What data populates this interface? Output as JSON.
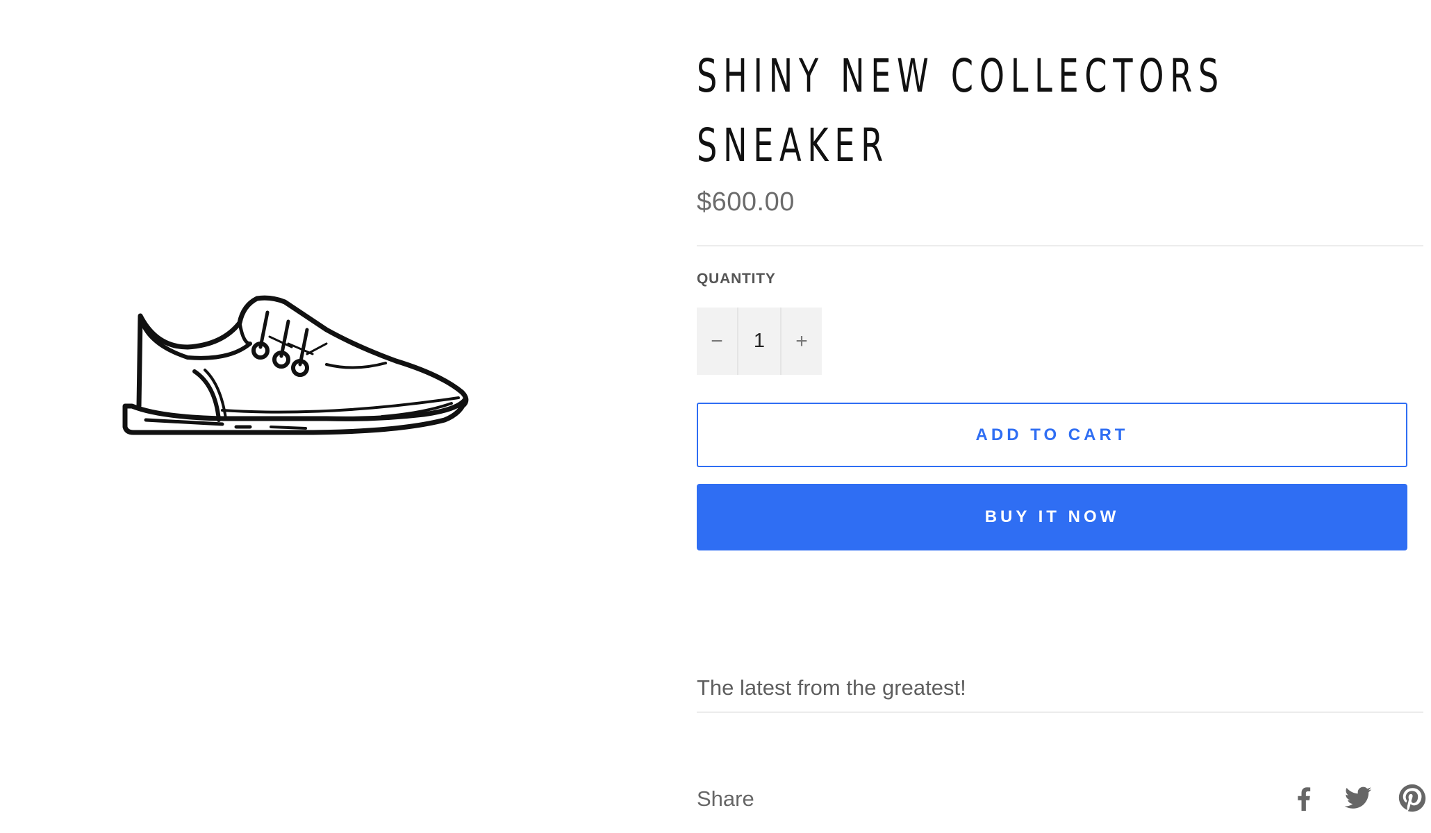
{
  "product": {
    "title": "SHINY NEW COLLECTORS SNEAKER",
    "price": "$600.00",
    "image_icon": "sneaker-illustration",
    "description": "The latest from the greatest!"
  },
  "quantity": {
    "label": "QUANTITY",
    "decrement_symbol": "−",
    "value": "1",
    "increment_symbol": "+"
  },
  "actions": {
    "add_to_cart": "ADD TO CART",
    "buy_now": "BUY IT NOW"
  },
  "share": {
    "label": "Share",
    "icons": [
      "facebook-icon",
      "twitter-icon",
      "pinterest-icon"
    ]
  },
  "colors": {
    "accent": "#2f6ef3",
    "title": "#111111",
    "muted": "#6b6b6b",
    "qty_bg": "#f2f2f2"
  }
}
